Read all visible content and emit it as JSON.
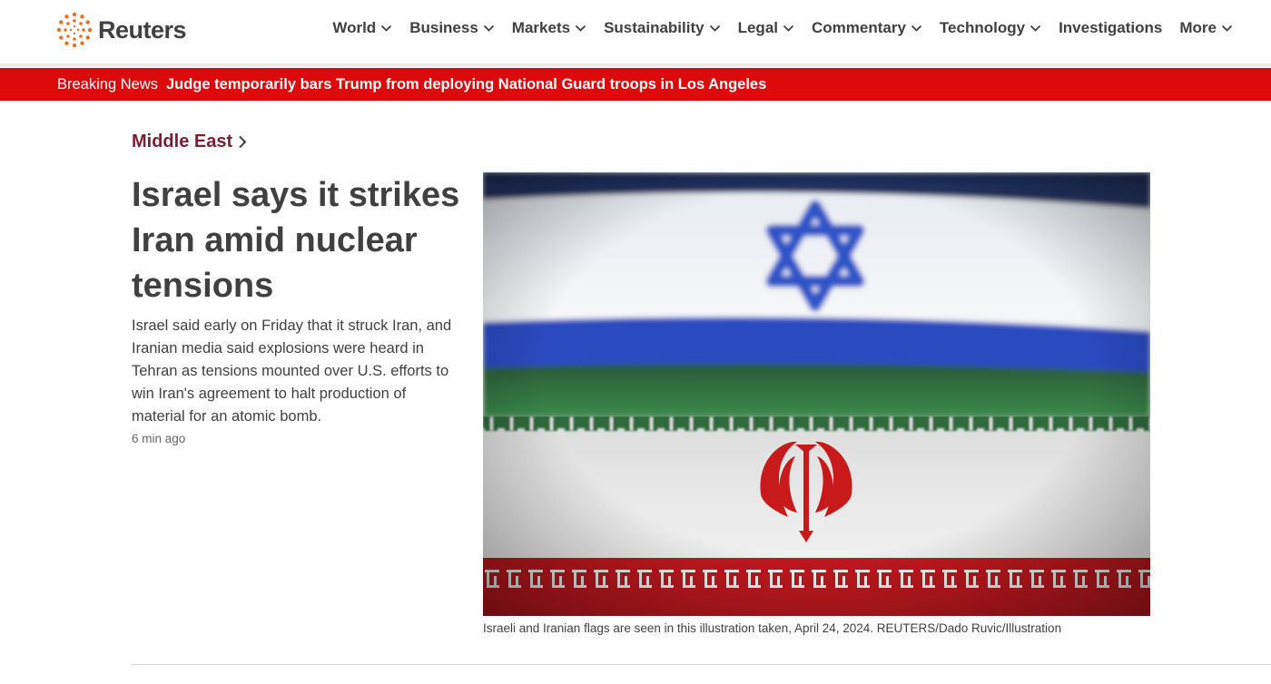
{
  "header": {
    "logo_text": "Reuters",
    "nav": [
      {
        "label": "World",
        "dropdown": true
      },
      {
        "label": "Business",
        "dropdown": true
      },
      {
        "label": "Markets",
        "dropdown": true
      },
      {
        "label": "Sustainability",
        "dropdown": true
      },
      {
        "label": "Legal",
        "dropdown": true
      },
      {
        "label": "Commentary",
        "dropdown": true
      },
      {
        "label": "Technology",
        "dropdown": true
      },
      {
        "label": "Investigations",
        "dropdown": false
      },
      {
        "label": "More",
        "dropdown": true
      }
    ]
  },
  "breaking": {
    "label": "Breaking News",
    "headline": "Judge temporarily bars Trump from deploying National Guard troops in Los Angeles"
  },
  "article": {
    "section": "Middle East",
    "headline": "Israel says it strikes Iran amid nuclear tensions",
    "summary": "Israel said early on Friday that it struck Iran, and Iranian media said explosions were heard in Tehran as tensions mounted over U.S. efforts to win Iran's agreement to halt production of material for an atomic bomb.",
    "time": "6 min ago",
    "image_caption": "Israeli and Iranian flags are seen in this illustration taken, April 24, 2024. REUTERS/Dado Ruvic/Illustration"
  },
  "colors": {
    "breaking_bg": "#dc0a0a",
    "section": "#7a1e32",
    "text": "#404040",
    "logo_orange": "#e3712a"
  },
  "icons": {
    "logo": "reuters-dots-logo",
    "nav_chevron": "chevron-down-icon",
    "section_chevron": "chevron-right-icon"
  }
}
